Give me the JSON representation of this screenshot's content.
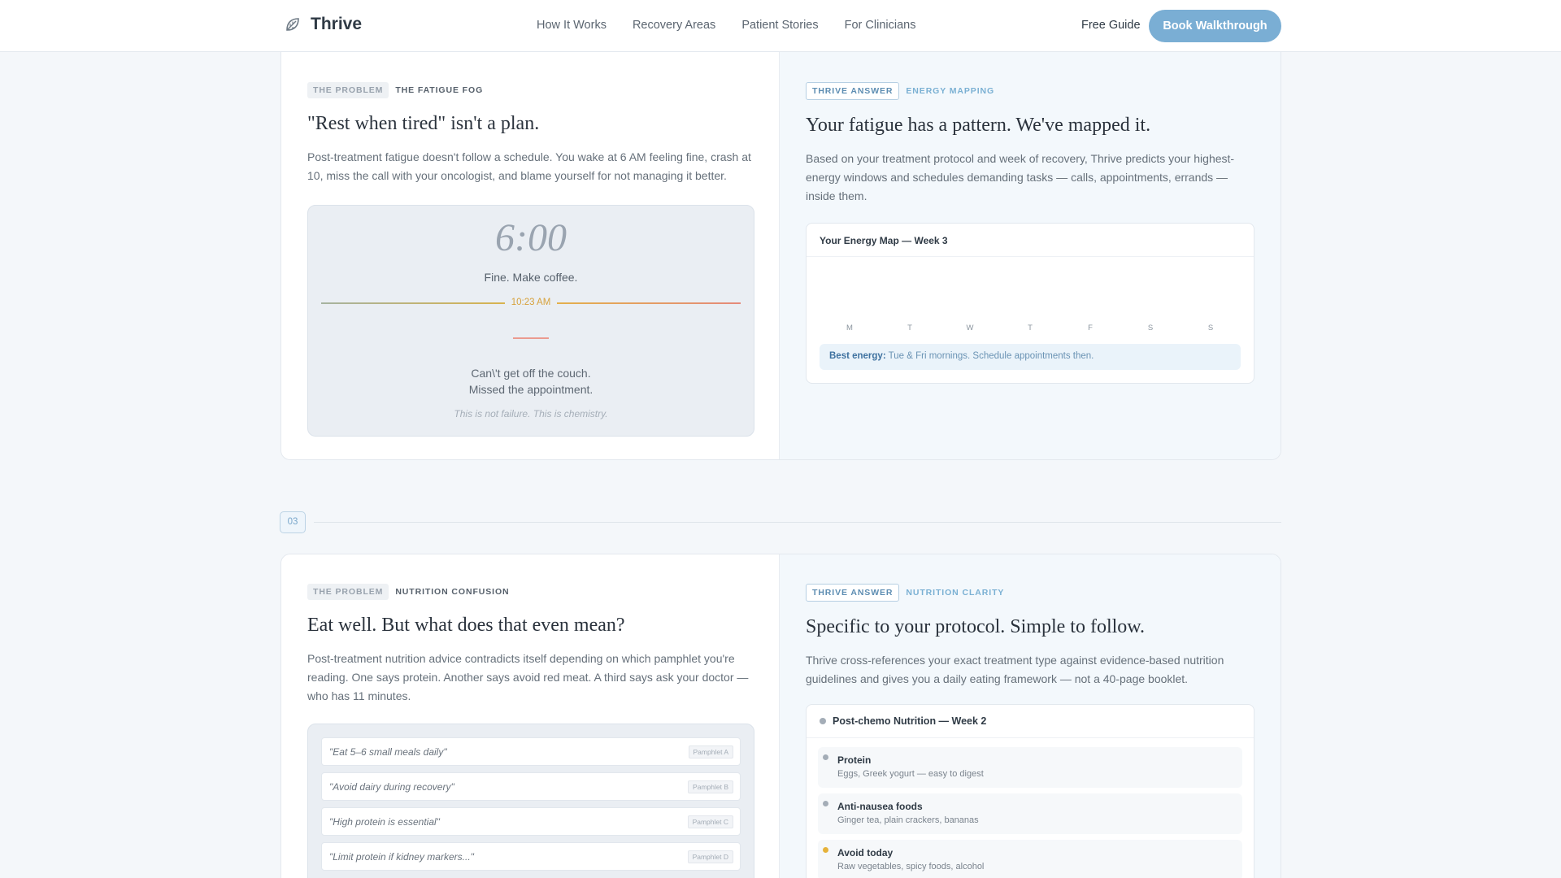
{
  "nav": {
    "brand": "Thrive",
    "links": [
      "How It Works",
      "Recovery Areas",
      "Patient Stories",
      "For Clinicians"
    ],
    "free_guide": "Free Guide",
    "cta": "Book Walkthrough"
  },
  "fatigue": {
    "problem_tag": "THE PROBLEM",
    "problem_sub": "THE FATIGUE FOG",
    "problem_title": "\"Rest when tired\" isn't a plan.",
    "problem_body": "Post-treatment fatigue doesn't follow a schedule. You wake at 6 AM feeling fine, crash at 10, miss the call with your oncologist, and blame yourself for not managing it better.",
    "clock": "6:00",
    "fine": "Fine. Make coffee.",
    "crash_time": "10:23 AM",
    "couch_line1": "Can\\'t get off the couch.",
    "couch_line2": "Missed the appointment.",
    "chemistry": "This is not failure. This is chemistry.",
    "answer_tag": "THRIVE ANSWER",
    "answer_sub": "ENERGY MAPPING",
    "answer_title": "Your fatigue has a pattern. We've mapped it.",
    "answer_body": "Based on your treatment protocol and week of recovery, Thrive predicts your highest-energy windows and schedules demanding tasks — calls, appointments, errands — inside them.",
    "map_title": "Your Energy Map — Week 3",
    "days": [
      "M",
      "T",
      "W",
      "T",
      "F",
      "S",
      "S"
    ],
    "best_label": "Best energy:",
    "best_text": "Tue & Fri mornings. Schedule appointments then."
  },
  "section_number": "03",
  "nutrition": {
    "problem_tag": "THE PROBLEM",
    "problem_sub": "NUTRITION CONFUSION",
    "problem_title": "Eat well. But what does that even mean?",
    "problem_body": "Post-treatment nutrition advice contradicts itself depending on which pamphlet you're reading. One says protein. Another says avoid red meat. A third says ask your doctor — who has 11 minutes.",
    "pamphlets": [
      {
        "quote": "\"Eat 5–6 small meals daily\"",
        "source": "Pamphlet A"
      },
      {
        "quote": "\"Avoid dairy during recovery\"",
        "source": "Pamphlet B"
      },
      {
        "quote": "\"High protein is essential\"",
        "source": "Pamphlet C"
      },
      {
        "quote": "\"Limit protein if kidney markers...\"",
        "source": "Pamphlet D"
      }
    ],
    "answer_tag": "THRIVE ANSWER",
    "answer_sub": "NUTRITION CLARITY",
    "answer_title": "Specific to your protocol. Simple to follow.",
    "answer_body": "Thrive cross-references your exact treatment type against evidence-based nutrition guidelines and gives you a daily eating framework — not a 40-page booklet.",
    "plan_title": "Post-chemo Nutrition — Week 2",
    "items": [
      {
        "name": "Protein",
        "desc": "Eggs, Greek yogurt — easy to digest"
      },
      {
        "name": "Anti-nausea foods",
        "desc": "Ginger tea, plain crackers, bananas"
      },
      {
        "name": "Avoid today",
        "desc": "Raw vegetables, spicy foods, alcohol"
      }
    ]
  },
  "colors": {
    "accent": "#7aaed4",
    "warning_dot": "#e6b23a",
    "crash_line": "#eb9a8f"
  }
}
